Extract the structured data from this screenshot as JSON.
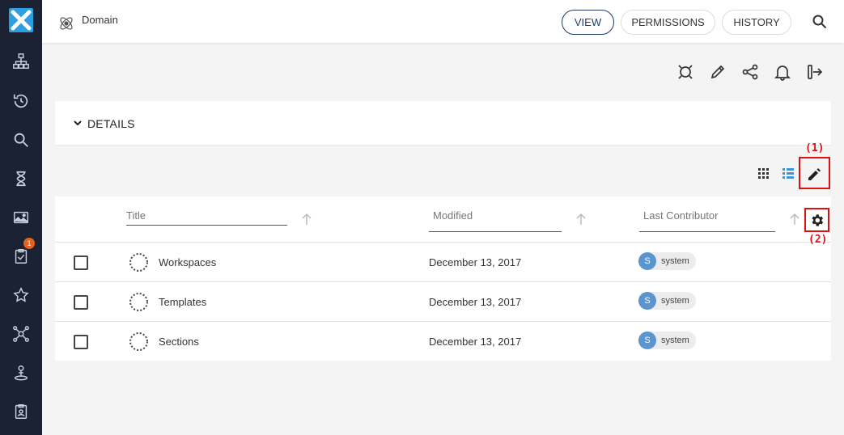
{
  "header": {
    "title": "Domain",
    "tabs": [
      {
        "label": "VIEW",
        "active": true
      },
      {
        "label": "PERMISSIONS",
        "active": false
      },
      {
        "label": "HISTORY",
        "active": false
      }
    ]
  },
  "sidebar": {
    "items": [
      {
        "icon": "sitemap-icon"
      },
      {
        "icon": "history-icon"
      },
      {
        "icon": "search-icon"
      },
      {
        "icon": "hourglass-icon"
      },
      {
        "icon": "images-icon"
      },
      {
        "icon": "tasks-icon",
        "badge": "1"
      },
      {
        "icon": "star-icon"
      },
      {
        "icon": "network-icon"
      },
      {
        "icon": "user-location-icon"
      },
      {
        "icon": "clipboard-user-icon"
      }
    ]
  },
  "details": {
    "label": "DETAILS"
  },
  "annotations": {
    "one": "(1)",
    "two": "(2)"
  },
  "table": {
    "columns": [
      "Title",
      "Modified",
      "Last Contributor"
    ],
    "rows": [
      {
        "title": "Workspaces",
        "modified": "December 13, 2017",
        "contributor": "system",
        "avatar": "S"
      },
      {
        "title": "Templates",
        "modified": "December 13, 2017",
        "contributor": "system",
        "avatar": "S"
      },
      {
        "title": "Sections",
        "modified": "December 13, 2017",
        "contributor": "system",
        "avatar": "S"
      }
    ]
  },
  "colors": {
    "sidebar": "#1a2233",
    "accent": "#2d9ee0",
    "badge": "#e8601b",
    "active_tab": "#1f3a6a",
    "annotation": "#dd1111"
  }
}
